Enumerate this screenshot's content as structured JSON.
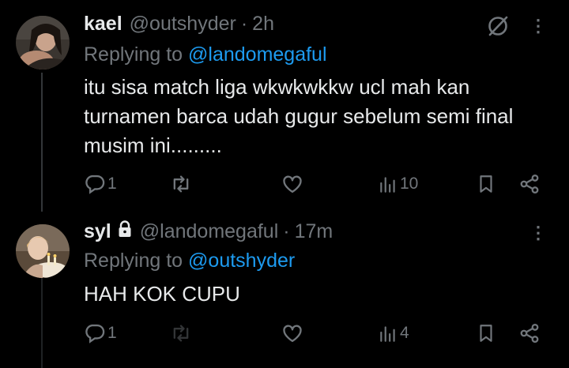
{
  "tweets": [
    {
      "name": "kael",
      "handle": "@outshyder",
      "separator": "·",
      "time": "2h",
      "replying_prefix": "Replying to",
      "replying_to": "@landomegaful",
      "body": [
        "itu sisa match liga wkwkwkkw ucl mah kan",
        "turnamen barca udah gugur sebelum semi final",
        "musim ini........."
      ],
      "replies": "1",
      "retweets": "",
      "likes": "",
      "views": "10"
    },
    {
      "name": "syl",
      "handle": "@landomegaful",
      "separator": "·",
      "time": "17m",
      "replying_prefix": "Replying to",
      "replying_to": "@outshyder",
      "body": [
        "HAH KOK CUPU"
      ],
      "replies": "1",
      "retweets": "",
      "likes": "",
      "views": "4"
    }
  ],
  "more_glyph": "⋮",
  "colors": {
    "background": "#000000",
    "text": "#e7e9ea",
    "muted": "#71767b",
    "link": "#1d9bf0"
  }
}
